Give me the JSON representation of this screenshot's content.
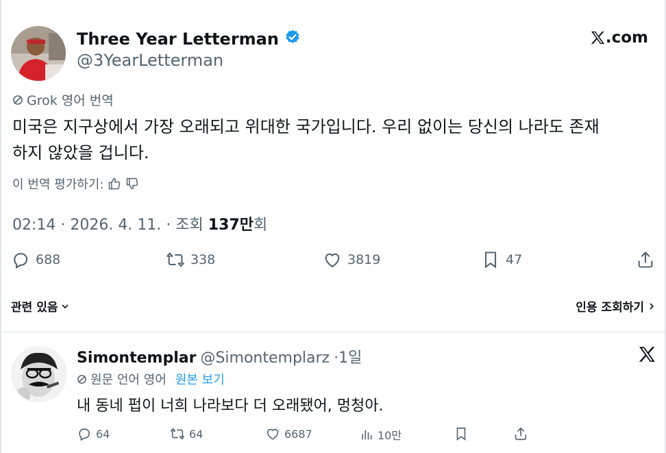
{
  "tweet": {
    "author_name": "Three Year Letterman",
    "author_handle": "@3YearLetterman",
    "site": ".com",
    "translation_label": "Grok 영어 번역",
    "body_line1": "미국은 지구상에서 가장 오래되고 위대한 국가입니다. 우리 없이는 당신의 나라도 존재",
    "body_line2": "하지 않았을 겁니다.",
    "rate_label": "이 번역 평가하기:",
    "meta_prefix": "02:14 · 2026. 4. 11. · 조회 ",
    "views": "137만",
    "views_suffix": "회",
    "replies": "688",
    "reposts": "338",
    "likes": "3819",
    "bookmarks": "47"
  },
  "related": {
    "label": "관련 있음",
    "quote_label": "인용 조회하기"
  },
  "reply": {
    "author_name": "Simontemplar",
    "author_handle": "@Simontemplarz",
    "time": "·1일",
    "lang_label": "원문 언어 영어",
    "view_original": "원본 보기",
    "text": "내 동네 펍이 너희 나라보다 더 오래됐어, 멍청아.",
    "replies": "64",
    "reposts": "64",
    "likes": "6687",
    "views": "10만"
  },
  "colors": {
    "accent": "#1d9bf0",
    "text": "#0f1419",
    "secondary": "#536471"
  }
}
